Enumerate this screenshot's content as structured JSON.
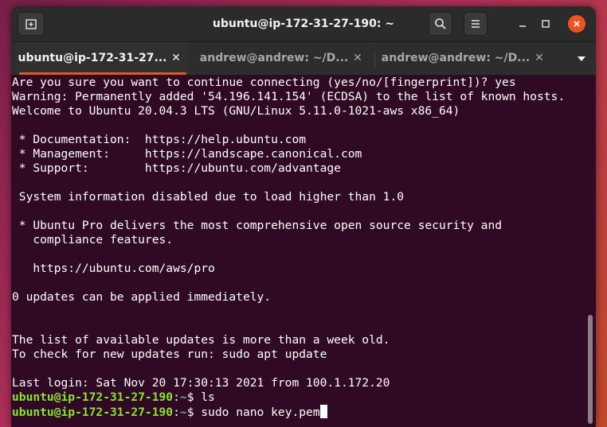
{
  "window": {
    "title": "ubuntu@ip-172-31-27-190: ~",
    "new_tab_icon": "new-tab-icon",
    "search_icon": "search-icon",
    "menu_icon": "hamburger-menu-icon",
    "close_color": "#e95420"
  },
  "tabs": [
    {
      "label": "ubuntu@ip-172-31-27...",
      "active": true
    },
    {
      "label": "andrew@andrew: ~/D...",
      "active": false
    },
    {
      "label": "andrew@andrew: ~/D...",
      "active": false
    }
  ],
  "terminal": {
    "background": "#300a24",
    "lines": [
      "Are you sure you want to continue connecting (yes/no/[fingerprint])? yes",
      "Warning: Permanently added '54.196.141.154' (ECDSA) to the list of known hosts.",
      "Welcome to Ubuntu 20.04.3 LTS (GNU/Linux 5.11.0-1021-aws x86_64)",
      "",
      " * Documentation:  https://help.ubuntu.com",
      " * Management:     https://landscape.canonical.com",
      " * Support:        https://ubuntu.com/advantage",
      "",
      " System information disabled due to load higher than 1.0",
      "",
      " * Ubuntu Pro delivers the most comprehensive open source security and",
      "   compliance features.",
      "",
      "   https://ubuntu.com/aws/pro",
      "",
      "0 updates can be applied immediately.",
      "",
      "",
      "The list of available updates is more than a week old.",
      "To check for new updates run: sudo apt update",
      "",
      "Last login: Sat Nov 20 17:30:13 2021 from 100.1.172.20"
    ],
    "prompt_user": "ubuntu@ip-172-31-27-190",
    "prompt_sep": ":",
    "prompt_path": "~",
    "prompt_symbol": "$ ",
    "commands": [
      "ls",
      "sudo nano key.pem"
    ]
  }
}
